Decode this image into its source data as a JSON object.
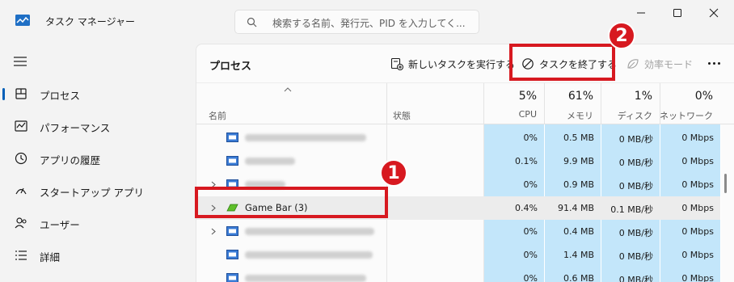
{
  "window": {
    "title": "タスク マネージャー",
    "search_placeholder": "検索する名前、発行元、PID を入力してく..."
  },
  "sidebar": {
    "items": [
      {
        "label": "プロセス",
        "icon": "processes-icon",
        "active": true
      },
      {
        "label": "パフォーマンス",
        "icon": "performance-icon"
      },
      {
        "label": "アプリの履歴",
        "icon": "history-icon"
      },
      {
        "label": "スタートアップ アプリ",
        "icon": "startup-icon"
      },
      {
        "label": "ユーザー",
        "icon": "users-icon"
      },
      {
        "label": "詳細",
        "icon": "details-icon"
      }
    ]
  },
  "toolbar": {
    "title": "プロセス",
    "new_task_label": "新しいタスクを実行する",
    "end_task_label": "タスクを終了する",
    "efficiency_label": "効率モード"
  },
  "table": {
    "columns": {
      "name": "名前",
      "status": "状態",
      "cpu": {
        "pct": "5%",
        "label": "CPU"
      },
      "memory": {
        "pct": "61%",
        "label": "メモリ"
      },
      "disk": {
        "pct": "1%",
        "label": "ディスク"
      },
      "network": {
        "pct": "0%",
        "label": "ネットワーク"
      }
    },
    "rows": [
      {
        "name": "",
        "expandable": false,
        "cpu": "0%",
        "memory": "0.5 MB",
        "disk": "0 MB/秒",
        "network": "0 Mbps"
      },
      {
        "name": "",
        "expandable": false,
        "cpu": "0.1%",
        "memory": "9.9 MB",
        "disk": "0 MB/秒",
        "network": "0 Mbps"
      },
      {
        "name": "",
        "expandable": true,
        "cpu": "0%",
        "memory": "0.9 MB",
        "disk": "0 MB/秒",
        "network": "0 Mbps"
      },
      {
        "name": "Game Bar (3)",
        "expandable": true,
        "cpu": "0.4%",
        "memory": "91.4 MB",
        "disk": "0.1 MB/秒",
        "network": "0 Mbps"
      },
      {
        "name": "",
        "expandable": true,
        "cpu": "0%",
        "memory": "0.4 MB",
        "disk": "0 MB/秒",
        "network": "0 Mbps"
      },
      {
        "name": "",
        "expandable": false,
        "cpu": "0%",
        "memory": "1.4 MB",
        "disk": "0 MB/秒",
        "network": "0 Mbps"
      },
      {
        "name": "",
        "expandable": false,
        "cpu": "0%",
        "memory": "0.6 MB",
        "disk": "0 MB/秒",
        "network": "0 Mbps"
      }
    ]
  },
  "annotations": {
    "badge_1": "1",
    "badge_2": "2",
    "color": "#d71920"
  },
  "colors": {
    "heat": "#c3e6fa",
    "accent": "#005fb8"
  }
}
